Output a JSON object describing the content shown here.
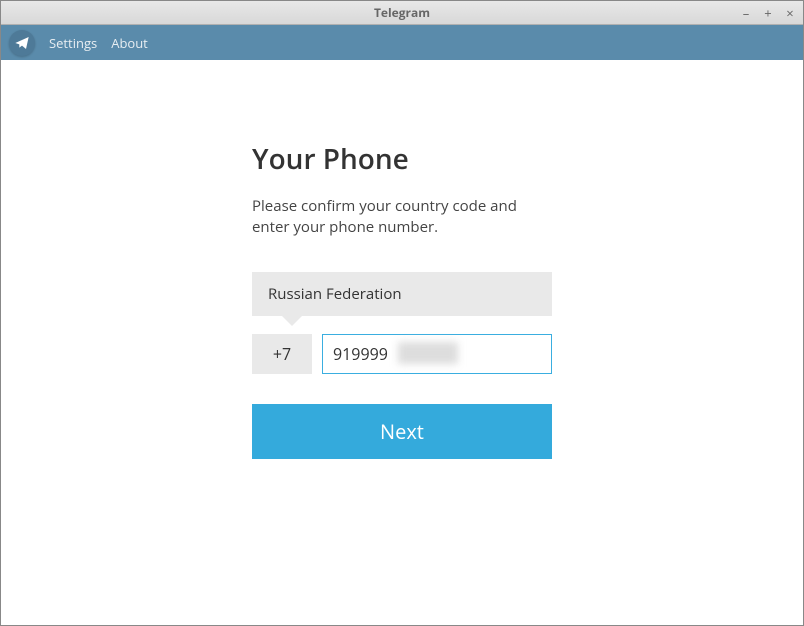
{
  "window": {
    "title": "Telegram"
  },
  "menubar": {
    "settings": "Settings",
    "about": "About"
  },
  "login": {
    "heading": "Your Phone",
    "subtext": "Please confirm your country code and enter your phone number.",
    "country": "Russian Federation",
    "country_code": "+7",
    "phone_value": "919999",
    "next_label": "Next"
  }
}
